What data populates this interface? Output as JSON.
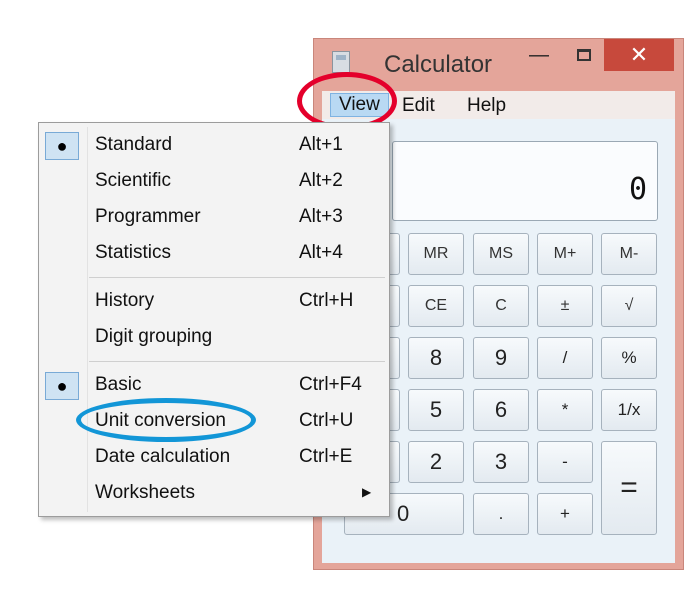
{
  "window": {
    "title": "Calculator",
    "minimize_label": "—",
    "close_label": "✕"
  },
  "menu_bar": {
    "view": "View",
    "edit": "Edit",
    "help": "Help"
  },
  "display": {
    "value": "0"
  },
  "keys": {
    "mr": "MR",
    "ms": "MS",
    "mplus": "M+",
    "mminus": "M-",
    "ce": "CE",
    "c": "C",
    "plusminus": "±",
    "sqrt": "√",
    "k8": "8",
    "k9": "9",
    "divide": "/",
    "percent": "%",
    "k5": "5",
    "k6": "6",
    "multiply": "*",
    "reciprocal": "1/x",
    "k2": "2",
    "k3": "3",
    "minus": "-",
    "equals": "=",
    "k0": "0",
    "decimal": ".",
    "plus": "+"
  },
  "view_menu": {
    "check_glyph": "●",
    "submenu_arrow": "▶",
    "items": [
      {
        "label": "Standard",
        "shortcut": "Alt+1",
        "checked": true
      },
      {
        "label": "Scientific",
        "shortcut": "Alt+2",
        "checked": false
      },
      {
        "label": "Programmer",
        "shortcut": "Alt+3",
        "checked": false
      },
      {
        "label": "Statistics",
        "shortcut": "Alt+4",
        "checked": false
      },
      {
        "label": "History",
        "shortcut": "Ctrl+H",
        "checked": false
      },
      {
        "label": "Digit grouping",
        "shortcut": "",
        "checked": false
      },
      {
        "label": "Basic",
        "shortcut": "Ctrl+F4",
        "checked": true
      },
      {
        "label": "Unit conversion",
        "shortcut": "Ctrl+U",
        "checked": false
      },
      {
        "label": "Date calculation",
        "shortcut": "Ctrl+E",
        "checked": false
      },
      {
        "label": "Worksheets",
        "shortcut": "",
        "checked": false
      }
    ]
  },
  "colors": {
    "window_frame": "#e4a59a",
    "close_button": "#c7493c",
    "menu_highlight": "#b9d9f3",
    "annotation_red": "#e4002b",
    "annotation_blue": "#1296d7"
  }
}
